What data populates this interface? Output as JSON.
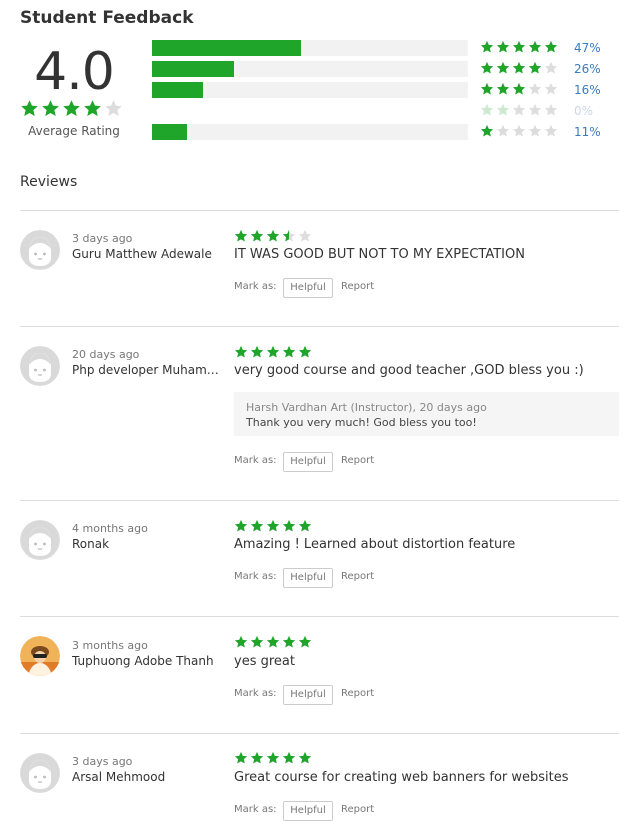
{
  "header": {
    "title": "Student Feedback"
  },
  "summary": {
    "average": "4.0",
    "average_stars": 4,
    "average_label": "Average Rating",
    "breakdown": [
      {
        "stars": 5,
        "percent_label": "47%",
        "percent": 47
      },
      {
        "stars": 4,
        "percent_label": "26%",
        "percent": 26
      },
      {
        "stars": 3,
        "percent_label": "16%",
        "percent": 16
      },
      {
        "stars": 2,
        "percent_label": "0%",
        "percent": 0
      },
      {
        "stars": 1,
        "percent_label": "11%",
        "percent": 11
      }
    ]
  },
  "reviews": {
    "title": "Reviews",
    "mark_as_label": "Mark as:",
    "helpful_label": "Helpful",
    "report_label": "Report",
    "items": [
      {
        "time": "3 days ago",
        "name": "Guru Matthew Adewale",
        "rating": 3.5,
        "text": "IT WAS GOOD BUT NOT TO MY EXPECTATION",
        "avatar": "default-face"
      },
      {
        "time": "20 days ago",
        "name": "Php developer Muhammad",
        "rating": 5,
        "text": "very good course and good teacher ,GOD bless you :)",
        "avatar": "default-face",
        "reply": {
          "meta": "Harsh Vardhan Art (Instructor), 20 days ago",
          "text": "Thank you very much! God bless you too!"
        }
      },
      {
        "time": "4 months ago",
        "name": "Ronak",
        "rating": 5,
        "text": "Amazing ! Learned about distortion feature",
        "avatar": "default-face"
      },
      {
        "time": "3 months ago",
        "name": "Tuphuong Adobe Thanh",
        "rating": 5,
        "text": "yes great",
        "avatar": "photo"
      },
      {
        "time": "3 days ago",
        "name": "Arsal Mehmood",
        "rating": 5,
        "text": "Great course for creating web banners for websites",
        "avatar": "default-face"
      }
    ]
  },
  "colors": {
    "star": "#1ea52a",
    "star_empty": "#dddddd",
    "star_faded": "#cfe9d1",
    "bar": "#1ea52a",
    "bar_track": "#f2f2f2",
    "link": "#3b7bbf"
  }
}
